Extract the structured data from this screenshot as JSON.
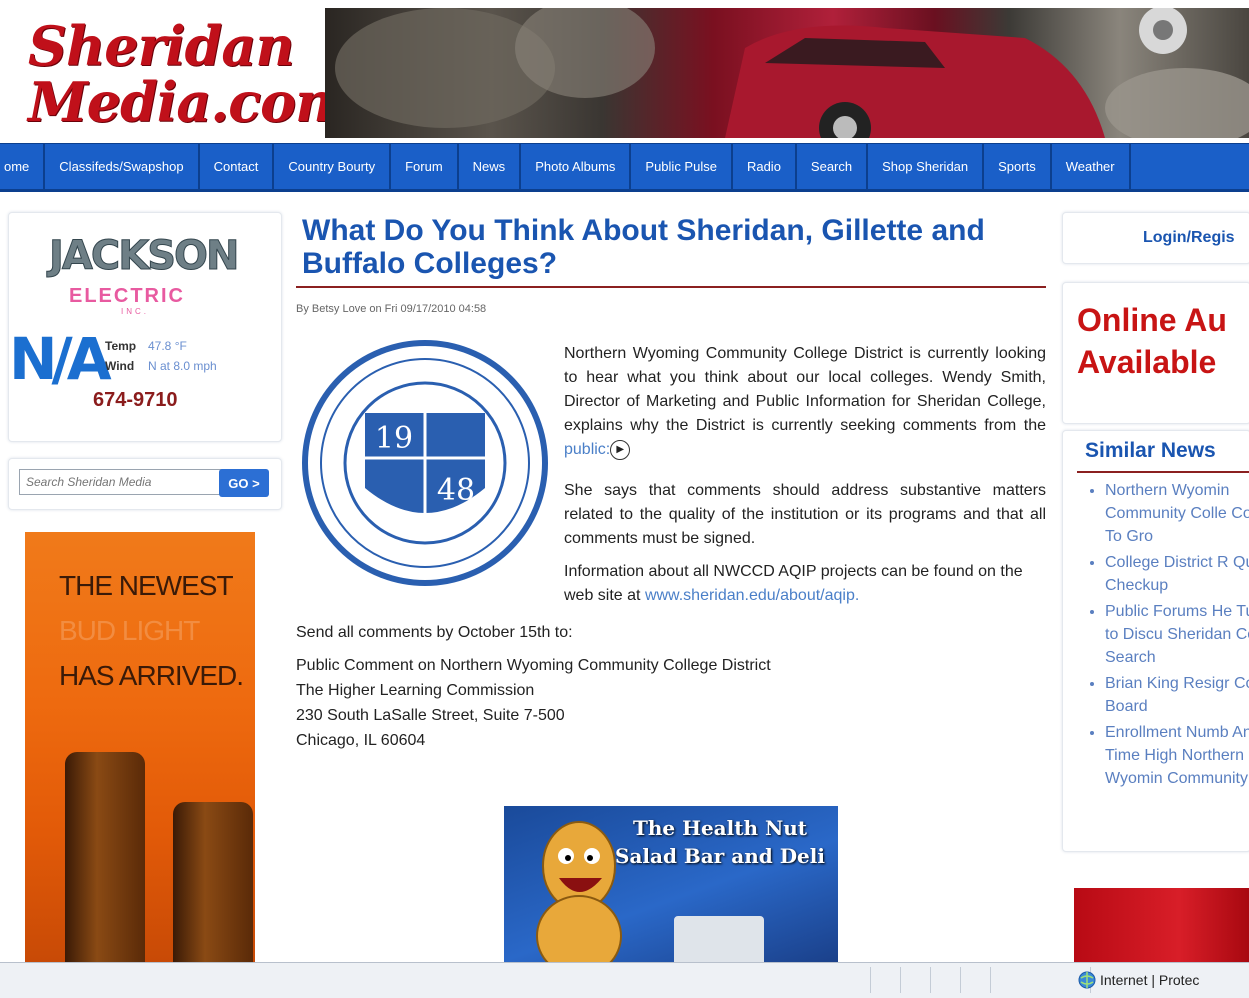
{
  "header": {
    "logo_line1": "Sheridan",
    "logo_line2": "Media.com"
  },
  "nav": [
    "ome",
    "Classifeds/Swapshop",
    "Contact",
    "Country Bourty",
    "Forum",
    "News",
    "Photo Albums",
    "Public Pulse",
    "Radio",
    "Search",
    "Shop Sheridan",
    "Sports",
    "Weather"
  ],
  "sidebar": {
    "sponsor_name": "JACKSON",
    "sponsor_sub": "ELECTRIC",
    "sponsor_inc": "INC.",
    "weather": {
      "big": "N/A",
      "temp_label": "Temp",
      "temp_value": "47.8 °F",
      "wind_label": "Wind",
      "wind_value": "N at 8.0 mph",
      "phone": "674-9710"
    },
    "search": {
      "placeholder": "Search Sheridan Media",
      "go_label": "GO >"
    },
    "ad": {
      "line1": "THE NEWEST",
      "line2": "BUD LIGHT",
      "line3": "HAS ARRIVED."
    }
  },
  "article": {
    "title": "What Do You Think About Sheridan, Gillette and Buffalo Colleges?",
    "byline": "By Betsy Love on Fri 09/17/2010 04:58",
    "seal_year_top": "19",
    "seal_year_bottom": "48",
    "p1": "Northern Wyoming Community College District is currently looking to hear what you think about our local colleges. Wendy Smith, Director of Marketing and Public Information for Sheridan College, explains why the District is currently seeking comments from the",
    "p1_link": "public:",
    "p2": "She says that comments should address substantive matters related to the quality of the institution or its programs and that all comments must be signed.",
    "p3": "Information about all NWCCD AQIP projects can be found on the web site at",
    "p3_link": "www.sheridan.edu/about/aqip.",
    "send_line": "Send all comments by October 15th to:",
    "address": [
      "Public Comment on Northern Wyoming Community College District",
      "The Higher Learning Commission",
      "230 South LaSalle Street, Suite 7-500",
      "Chicago, IL 60604"
    ],
    "ad_line1": "The Health Nut",
    "ad_line2": "Salad Bar and Deli"
  },
  "right": {
    "login": "Login/Regis",
    "auction_line1": "Online Au",
    "auction_line2": "Available",
    "similar_title": "Similar News",
    "similar_items": [
      "Northern Wyomin Community Colle Continues To Gro",
      "College District R Quality Checkup",
      "Public Forums He Tuesday to Discu Sheridan College Search",
      "Brian King Resigr College Board",
      "Enrollment Numb An All Time High Northern Wyomin Community Colle"
    ]
  },
  "statusbar": {
    "zone": "Internet | Protec"
  },
  "colors": {
    "nav_blue": "#1a5fc8",
    "title_blue": "#1a55b0",
    "accent_red": "#c81414"
  }
}
